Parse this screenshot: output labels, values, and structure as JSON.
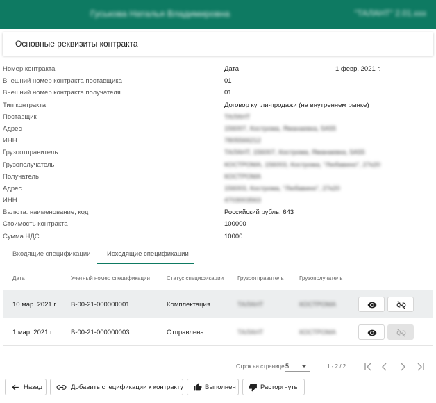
{
  "header": {
    "user_name": "Гуськова Наталья Владимировна",
    "org_name": "\"ТАЛАНТ\" 2.01.xxx"
  },
  "page_title": "Основные реквизиты контракта",
  "fields": [
    {
      "label": "Номер контракта",
      "value": "Дата",
      "date": "1 февр. 2021 г.",
      "blurred": false
    },
    {
      "label": "Внешний номер контракта поставщика",
      "value": "01",
      "blurred": false
    },
    {
      "label": "Внешний номер контракта получателя",
      "value": "01",
      "blurred": false
    },
    {
      "label": "Тип контракта",
      "value": "Договор купли-продажи (на внутреннем рынке)",
      "blurred": false
    },
    {
      "label": "Поставщик",
      "value": "ТАЛАНТ",
      "blurred": true
    },
    {
      "label": "Адрес",
      "value": "156007, Кострома, Яманаевка, 5А55",
      "blurred": true
    },
    {
      "label": "ИНН",
      "value": "7805566212",
      "blurred": true
    },
    {
      "label": "Грузоотправитель",
      "value": "ТАЛАНТ, 156007, Кострома, Яманаевка, 5А55",
      "blurred": true
    },
    {
      "label": "Грузополучатель",
      "value": "КОСТРОМА, 156003, Кострома, \"Любавино\", 27к20",
      "blurred": true
    },
    {
      "label": "Получатель",
      "value": "КОСТРОМА",
      "blurred": true
    },
    {
      "label": "Адрес",
      "value": "156003, Кострома, \"Любавино\", 27к20",
      "blurred": true
    },
    {
      "label": "ИНН",
      "value": "4703003563",
      "blurred": true
    },
    {
      "label": "Валюта: наименование, код",
      "value": "Российский рубль, 643",
      "blurred": false
    },
    {
      "label": "Стоимость контракта",
      "value": "100000",
      "blurred": false
    },
    {
      "label": "Сумма НДС",
      "value": "10000",
      "blurred": false
    }
  ],
  "tabs": {
    "incoming": "Входящие спецификации",
    "outgoing": "Исходящие спецификации",
    "active": "outgoing"
  },
  "table": {
    "headers": [
      "Дата",
      "Учетный номер спецификации",
      "Статус спецификации",
      "Грузоотправитель",
      "Грузополучатель"
    ],
    "rows": [
      {
        "date": "10 мар. 2021 г.",
        "number": "В-00-21-000000001",
        "status": "Комплектация",
        "shipper": "ТАЛАНТ",
        "consignee": "КОСТРОМА",
        "selected": true,
        "unlink_enabled": true
      },
      {
        "date": "1 мар. 2021 г.",
        "number": "В-00-21-000000003",
        "status": "Отправлена",
        "shipper": "ТАЛАНТ",
        "consignee": "КОСТРОМА",
        "selected": false,
        "unlink_enabled": false
      }
    ]
  },
  "pagination": {
    "rows_per_page_label": "Строк на странице:",
    "rows_per_page": "5",
    "range": "1 - 2 / 2"
  },
  "actions": {
    "back": "Назад",
    "add_spec": "Добавить спецификации к контракту",
    "done": "Выполнен",
    "terminate": "Расторгнуть"
  },
  "colors": {
    "header_bg": "#0e7a62",
    "selected_row_bg": "#eceeef",
    "accent": "#0e7a62"
  }
}
